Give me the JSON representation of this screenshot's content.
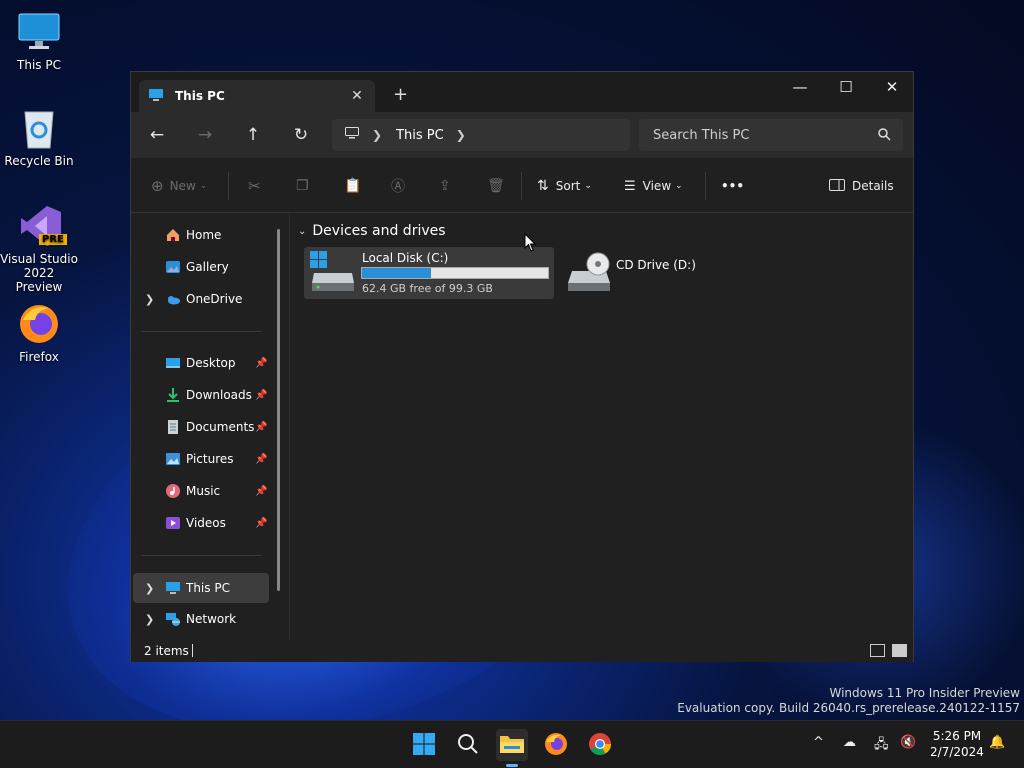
{
  "desktop": {
    "icons": [
      {
        "label": "This PC"
      },
      {
        "label": "Recycle Bin"
      },
      {
        "label_line1": "Visual Studio",
        "label_line2": "2022 Preview",
        "badge": "PRE"
      },
      {
        "label": "Firefox"
      }
    ],
    "watermark": {
      "line1": "Windows 11 Pro Insider Preview",
      "line2": "Evaluation copy. Build 26040.rs_prerelease.240122-1157"
    }
  },
  "explorer": {
    "tab_title": "This PC",
    "new_tab_label": "+",
    "breadcrumb": {
      "location": "This PC"
    },
    "search": {
      "placeholder": "Search This PC"
    },
    "toolbar": {
      "new_label": "New",
      "sort_label": "Sort",
      "view_label": "View",
      "more_label": "•••",
      "details_label": "Details"
    },
    "sidebar": {
      "home": "Home",
      "gallery": "Gallery",
      "onedrive": "OneDrive",
      "desktop": "Desktop",
      "downloads": "Downloads",
      "documents": "Documents",
      "pictures": "Pictures",
      "music": "Music",
      "videos": "Videos",
      "this_pc": "This PC",
      "network": "Network"
    },
    "content": {
      "group_header": "Devices and drives",
      "drives": [
        {
          "name": "Local Disk (C:)",
          "free_text": "62.4 GB free of 99.3 GB",
          "used_fraction": 0.372
        },
        {
          "name": "CD Drive (D:)"
        }
      ]
    },
    "status": {
      "item_count": "2 items"
    }
  },
  "taskbar": {
    "clock_time": "5:26 PM",
    "clock_date": "2/7/2024"
  },
  "colors": {
    "accent": "#2b8fd8",
    "window_bg": "#202020"
  }
}
